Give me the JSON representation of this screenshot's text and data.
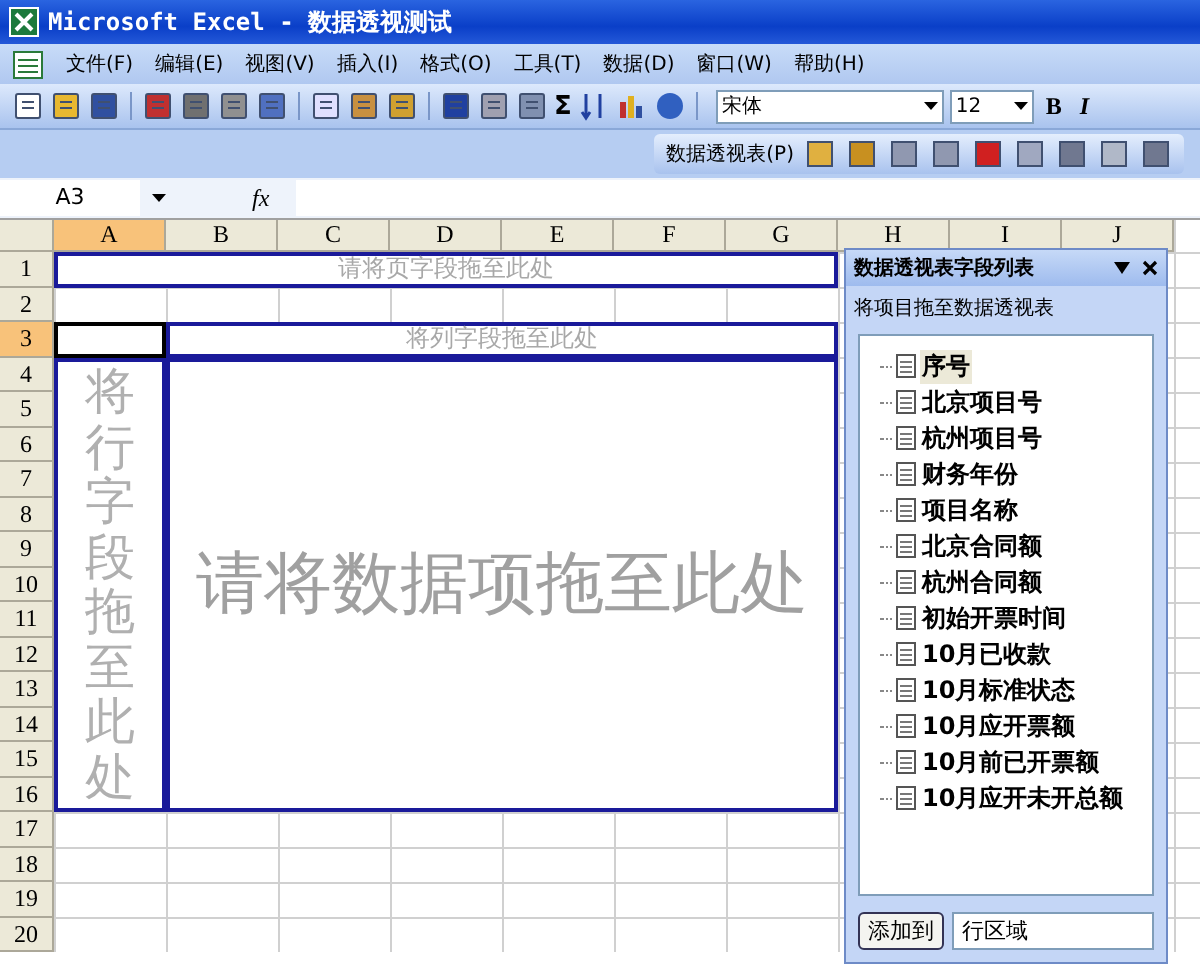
{
  "window": {
    "title": "Microsoft Excel - 数据透视测试"
  },
  "menu": [
    {
      "label": "文件(F)"
    },
    {
      "label": "编辑(E)"
    },
    {
      "label": "视图(V)"
    },
    {
      "label": "插入(I)"
    },
    {
      "label": "格式(O)"
    },
    {
      "label": "工具(T)"
    },
    {
      "label": "数据(D)"
    },
    {
      "label": "窗口(W)"
    },
    {
      "label": "帮助(H)"
    }
  ],
  "toolbar": {
    "sum": "Σ",
    "font": "宋体",
    "size": "12",
    "bold": "B",
    "italic": "I"
  },
  "pivot_toolbar": {
    "label": "数据透视表(P)"
  },
  "formula_bar": {
    "name_box": "A3",
    "fx": "fx"
  },
  "columns": [
    {
      "label": "A",
      "selected": true
    },
    {
      "label": "B",
      "selected": false
    },
    {
      "label": "C",
      "selected": false
    },
    {
      "label": "D",
      "selected": false
    },
    {
      "label": "E",
      "selected": false
    },
    {
      "label": "F",
      "selected": false
    },
    {
      "label": "G",
      "selected": false
    },
    {
      "label": "H",
      "selected": false
    },
    {
      "label": "I",
      "selected": false
    },
    {
      "label": "J",
      "selected": false
    }
  ],
  "rows": [
    {
      "label": "1",
      "selected": false
    },
    {
      "label": "2",
      "selected": false
    },
    {
      "label": "3",
      "selected": true
    },
    {
      "label": "4",
      "selected": false
    },
    {
      "label": "5",
      "selected": false
    },
    {
      "label": "6",
      "selected": false
    },
    {
      "label": "7",
      "selected": false
    },
    {
      "label": "8",
      "selected": false
    },
    {
      "label": "9",
      "selected": false
    },
    {
      "label": "10",
      "selected": false
    },
    {
      "label": "11",
      "selected": false
    },
    {
      "label": "12",
      "selected": false
    },
    {
      "label": "13",
      "selected": false
    },
    {
      "label": "14",
      "selected": false
    },
    {
      "label": "15",
      "selected": false
    },
    {
      "label": "16",
      "selected": false
    },
    {
      "label": "17",
      "selected": false
    },
    {
      "label": "18",
      "selected": false
    },
    {
      "label": "19",
      "selected": false
    },
    {
      "label": "20",
      "selected": false
    }
  ],
  "drop_zones": {
    "page": "请将页字段拖至此处",
    "column": "将列字段拖至此处",
    "row": "将行字段拖至此处",
    "data": "请将数据项拖至此处"
  },
  "field_list": {
    "title": "数据透视表字段列表",
    "hint": "将项目拖至数据透视表",
    "fields": [
      {
        "label": "序号",
        "selected": true
      },
      {
        "label": "北京项目号",
        "selected": false
      },
      {
        "label": "杭州项目号",
        "selected": false
      },
      {
        "label": "财务年份",
        "selected": false
      },
      {
        "label": "项目名称",
        "selected": false
      },
      {
        "label": "北京合同额",
        "selected": false
      },
      {
        "label": "杭州合同额",
        "selected": false
      },
      {
        "label": "初始开票时间",
        "selected": false
      },
      {
        "label": "10月已收款",
        "selected": false
      },
      {
        "label": "10月标准状态",
        "selected": false
      },
      {
        "label": "10月应开票额",
        "selected": false
      },
      {
        "label": "10月前已开票额",
        "selected": false
      },
      {
        "label": "10月应开未开总额",
        "selected": false
      }
    ],
    "add_button": "添加到",
    "area": "行区域"
  }
}
